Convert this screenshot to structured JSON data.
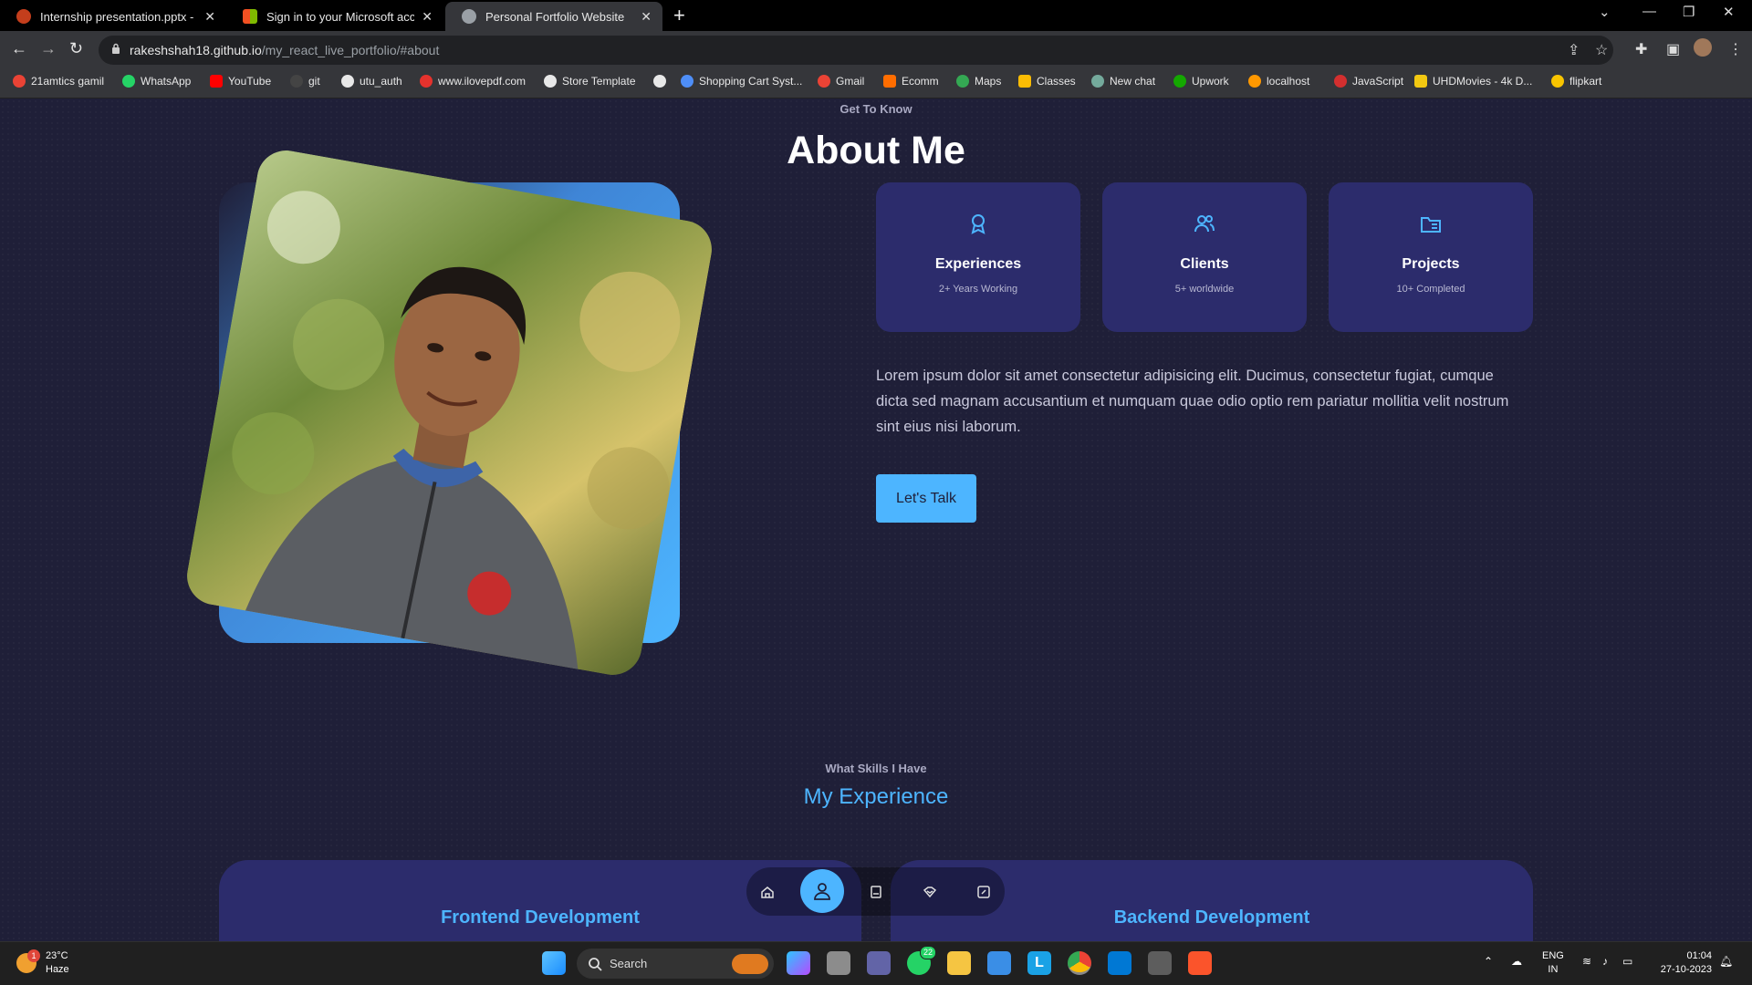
{
  "browser": {
    "tabs": [
      {
        "title": "Internship presentation.pptx - M",
        "color": "#c43e1c"
      },
      {
        "title": "Sign in to your Microsoft accoun",
        "color": "#f25022"
      },
      {
        "title": "Personal Fortfolio Website",
        "color": "#9aa0a6"
      }
    ],
    "url_host": "rakeshshah18.github.io",
    "url_path": "/my_react_live_portfolio/#about",
    "bookmarks": [
      {
        "label": "21amtics gamil",
        "color": "#ea4335"
      },
      {
        "label": "WhatsApp",
        "color": "#25d366"
      },
      {
        "label": "YouTube",
        "color": "#ff0000"
      },
      {
        "label": "git",
        "color": "#444444"
      },
      {
        "label": "utu_auth",
        "color": "#e8e8e8"
      },
      {
        "label": "www.ilovepdf.com",
        "color": "#e5322d"
      },
      {
        "label": "Store Template",
        "color": "#e8e8e8"
      },
      {
        "label": "",
        "color": "#e8e8e8"
      },
      {
        "label": "Shopping Cart Syst...",
        "color": "#4e8ef7"
      },
      {
        "label": "Gmail",
        "color": "#ea4335"
      },
      {
        "label": "Ecomm",
        "color": "#ff6d00"
      },
      {
        "label": "Maps",
        "color": "#34a853"
      },
      {
        "label": "Classes",
        "color": "#fbbc04"
      },
      {
        "label": "New chat",
        "color": "#74aa9c"
      },
      {
        "label": "Upwork",
        "color": "#14a800"
      },
      {
        "label": "localhost",
        "color": "#ff9800"
      },
      {
        "label": "JavaScript",
        "color": "#d32f2f"
      },
      {
        "label": "UHDMovies - 4k D...",
        "color": "#f2c811"
      },
      {
        "label": "flipkart",
        "color": "#f8c400"
      }
    ]
  },
  "about": {
    "subtitle": "Get To Know",
    "title": "About Me",
    "cards": [
      {
        "icon": "award-icon",
        "title": "Experiences",
        "sub": "2+ Years Working"
      },
      {
        "icon": "users-icon",
        "title": "Clients",
        "sub": "5+ worldwide"
      },
      {
        "icon": "folder-icon",
        "title": "Projects",
        "sub": "10+ Completed"
      }
    ],
    "text": "Lorem ipsum dolor sit amet consectetur adipisicing elit. Ducimus, consectetur fugiat, cumque dicta sed magnam accusantium et numquam quae odio optio rem pariatur mollitia velit nostrum sint eius nisi laborum.",
    "button": "Let's Talk"
  },
  "experience": {
    "subtitle": "What Skills I Have",
    "title": "My Experience",
    "panels": [
      "Frontend Development",
      "Backend Development"
    ]
  },
  "float_nav": [
    {
      "icon": "home-icon"
    },
    {
      "icon": "user-icon",
      "active": true
    },
    {
      "icon": "book-icon"
    },
    {
      "icon": "services-icon"
    },
    {
      "icon": "message-icon"
    }
  ],
  "colors": {
    "accent": "#4db5ff",
    "bg": "#1f1f38",
    "card": "#2c2c6c"
  },
  "taskbar": {
    "weather_temp": "23°C",
    "weather_desc": "Haze",
    "weather_badge": "1",
    "search": "Search",
    "whatsapp_badge": "22",
    "lang_top": "ENG",
    "lang_bottom": "IN",
    "time": "01:04",
    "date": "27-10-2023"
  }
}
